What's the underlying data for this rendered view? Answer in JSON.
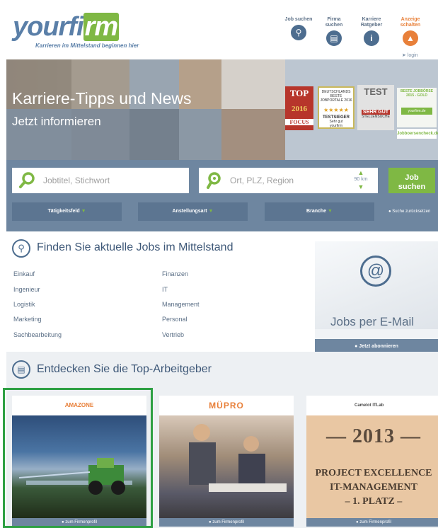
{
  "header": {
    "logo_text": "yourfi",
    "logo_mark": "rm",
    "tagline": "Karrieren im Mittelstand beginnen hier",
    "nav": [
      {
        "label": "Job suchen",
        "icon": "search-icon"
      },
      {
        "label": "Firma suchen",
        "icon": "building-icon"
      },
      {
        "label": "Karriere Ratgeber",
        "icon": "info-icon"
      },
      {
        "label": "Anzeige schalten",
        "icon": "flame-icon"
      }
    ],
    "login": "login",
    "accent_color": "#e8803a",
    "brand_color": "#5a7fa8"
  },
  "hero": {
    "title": "Karriere-Tipps und News",
    "subtitle": "Jetzt informieren",
    "badges": {
      "top": {
        "line1": "TOP",
        "line2": "2016",
        "line3": "FOCUS"
      },
      "testsieger": {
        "head": "DEUTSCHLANDS BESTE JOBPORTALE 2016",
        "label": "TESTSIEGER",
        "rating": "Sehr gut",
        "source": "yourfirm"
      },
      "test": {
        "head": "TEST",
        "label": "SEHR GUT",
        "sub": "STELLENSUCHE"
      },
      "green": {
        "head": "BESTE JOBBÖRSE 2015 - GOLD",
        "label": "yourfirm.de"
      },
      "jobboerse": "Jobboersencheck.de"
    }
  },
  "search": {
    "job_placeholder": "Jobtitel, Stichwort",
    "location_placeholder": "Ort, PLZ, Region",
    "radius": "90 km",
    "button_line1": "Job",
    "button_line2": "suchen",
    "filters": [
      "Tätigkeitsfeld",
      "Anstellungsart",
      "Branche"
    ],
    "reset": "Suche zurücksetzen",
    "accent_green": "#7fb844"
  },
  "jobs": {
    "heading": "Finden Sie aktuelle Jobs im Mittelstand",
    "categories_left": [
      "Einkauf",
      "Ingenieur",
      "Logistik",
      "Marketing",
      "Sachbearbeitung"
    ],
    "categories_right": [
      "Finanzen",
      "IT",
      "Management",
      "Personal",
      "Vertrieb"
    ],
    "email_title": "Jobs per E-Mail",
    "email_cta": "Jetzt abonnieren"
  },
  "employers": {
    "heading": "Entdecken Sie die Top-Arbeitgeber",
    "cards": [
      {
        "logo": "AMAZONE",
        "cta": "zum Firmenprofil"
      },
      {
        "logo": "MÜPRO",
        "cta": "zum Firmenprofil"
      },
      {
        "logo": "Camelot ITLab",
        "cta": "zum Firmenprofil",
        "year": "— 2013 —",
        "lines": [
          "PROJECT EXCELLENCE",
          "IT-MANAGEMENT",
          "– 1. PLATZ –"
        ]
      }
    ],
    "highlight_color": "#2ea043"
  }
}
